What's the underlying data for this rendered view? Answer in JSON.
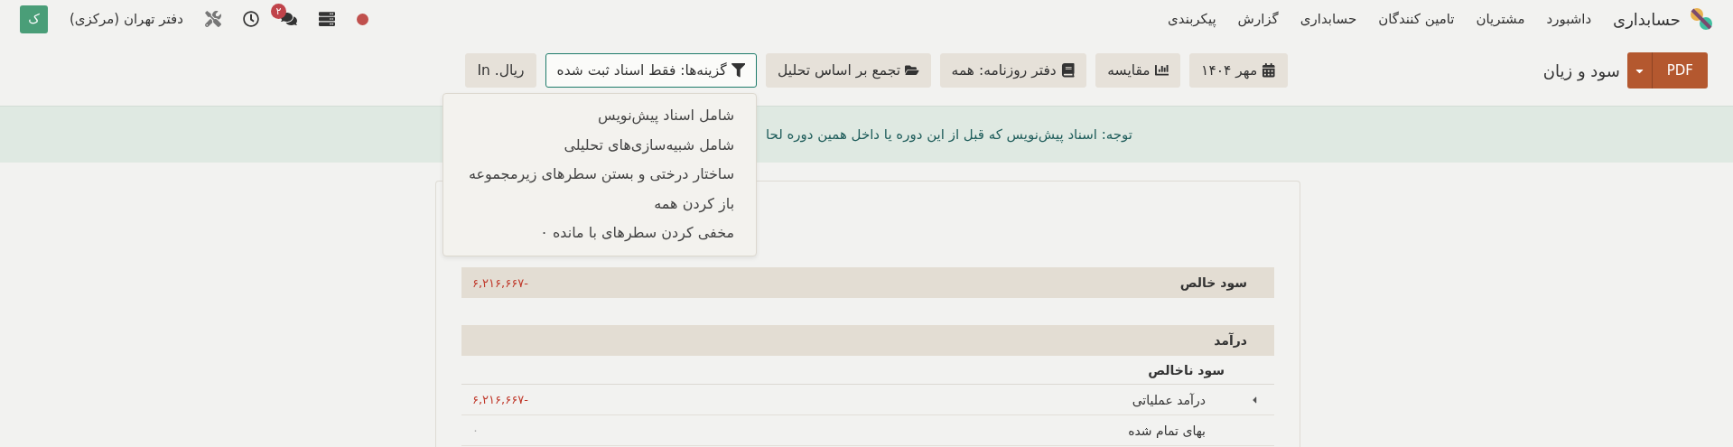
{
  "navbar": {
    "app_name": "حسابداری",
    "menu": [
      "داشبورد",
      "مشتریان",
      "تامین کنندگان",
      "حسابداری",
      "گزارش",
      "پیکربندی"
    ],
    "message_count": "۲",
    "company": "دفتر تهران (مرکزی)",
    "avatar": "ک"
  },
  "toolbar": {
    "export": "PDF",
    "title": "سود و زیان",
    "filters": [
      {
        "kind": "date",
        "label": "مهر ۱۴۰۴",
        "selected": false
      },
      {
        "kind": "compare",
        "label": "مقایسه",
        "selected": false
      },
      {
        "kind": "journal",
        "label": "دفتر روزنامه: همه",
        "selected": false
      },
      {
        "kind": "analytic",
        "label": "تجمع بر اساس تحلیل",
        "selected": false
      },
      {
        "kind": "options",
        "label": "گزینه‌ها: فقط اسناد ثبت شده",
        "selected": true
      },
      {
        "kind": "currency",
        "label": "In .ریال",
        "selected": false
      }
    ]
  },
  "options_menu": [
    "شامل اسناد پیش‌نویس",
    "شامل شبیه‌سازی‌های تحلیلی",
    "ساختار درختی و بستن سطرهای زیرمجموعه",
    "باز کردن همه",
    "مخفی کردن سطرهای با مانده ۰"
  ],
  "notice": "توجه: اسناد پیش‌نویس که قبل از این دوره یا داخل همین دوره لحا",
  "report": {
    "rows": [
      {
        "kind": "header",
        "label": "سود خالص",
        "value": "۶,۲۱۶,۶۶۷-",
        "negative": true
      },
      {
        "kind": "header",
        "label": "درآمد"
      },
      {
        "kind": "subtotal",
        "label": "سود ناخالص"
      },
      {
        "kind": "line",
        "label": "درآمد عملیاتی",
        "value": "۶,۲۱۶,۶۶۷-",
        "negative": true,
        "expandable": true
      },
      {
        "kind": "line",
        "label": "بهای تمام شده",
        "value": "۰",
        "negative": false,
        "expandable": false
      }
    ]
  }
}
